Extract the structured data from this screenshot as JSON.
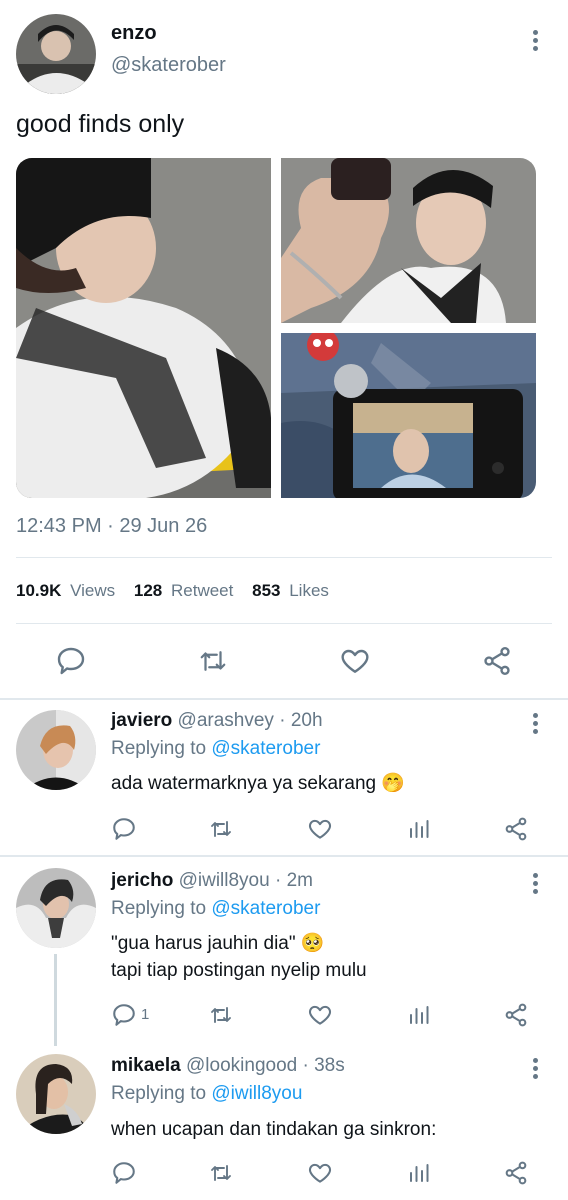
{
  "tweet": {
    "display_name": "enzo",
    "handle": "@skaterober",
    "text": "good finds only",
    "timestamp": "12:43 PM · 29 Jun 26",
    "stats": {
      "views_count": "10.9K",
      "views_label": "Views",
      "retweet_count": "128",
      "retweet_label": "Retweet",
      "likes_count": "853",
      "likes_label": "Likes"
    }
  },
  "replies": [
    {
      "display_name": "javiero",
      "handle": "@arashvey",
      "age": "· 20h",
      "replying_label": "Replying to",
      "replying_to": "@skaterober",
      "lines": [
        "ada watermarknya ya sekarang 🤭"
      ],
      "reply_count": ""
    },
    {
      "display_name": "jericho",
      "handle": "@iwill8you",
      "age": "· 2m",
      "replying_label": "Replying to",
      "replying_to": "@skaterober",
      "lines": [
        "\"gua harus jauhin dia\" 🥺",
        "tapi tiap postingan nyelip mulu"
      ],
      "reply_count": "1"
    },
    {
      "display_name": "mikaela",
      "handle": "@lookingood",
      "age": "· 38s",
      "replying_label": "Replying to",
      "replying_to": "@iwill8you",
      "lines": [
        "when ucapan dan tindakan ga sinkron:"
      ],
      "reply_count": ""
    }
  ],
  "icons": {
    "reply": "reply-icon",
    "retweet": "retweet-icon",
    "like": "heart-icon",
    "share": "share-icon",
    "analytics": "analytics-icon",
    "more": "more-options-icon"
  },
  "colors": {
    "link": "#1d9bf0",
    "muted": "#657786",
    "text": "#0f1419",
    "divider": "#e1e8ed"
  }
}
